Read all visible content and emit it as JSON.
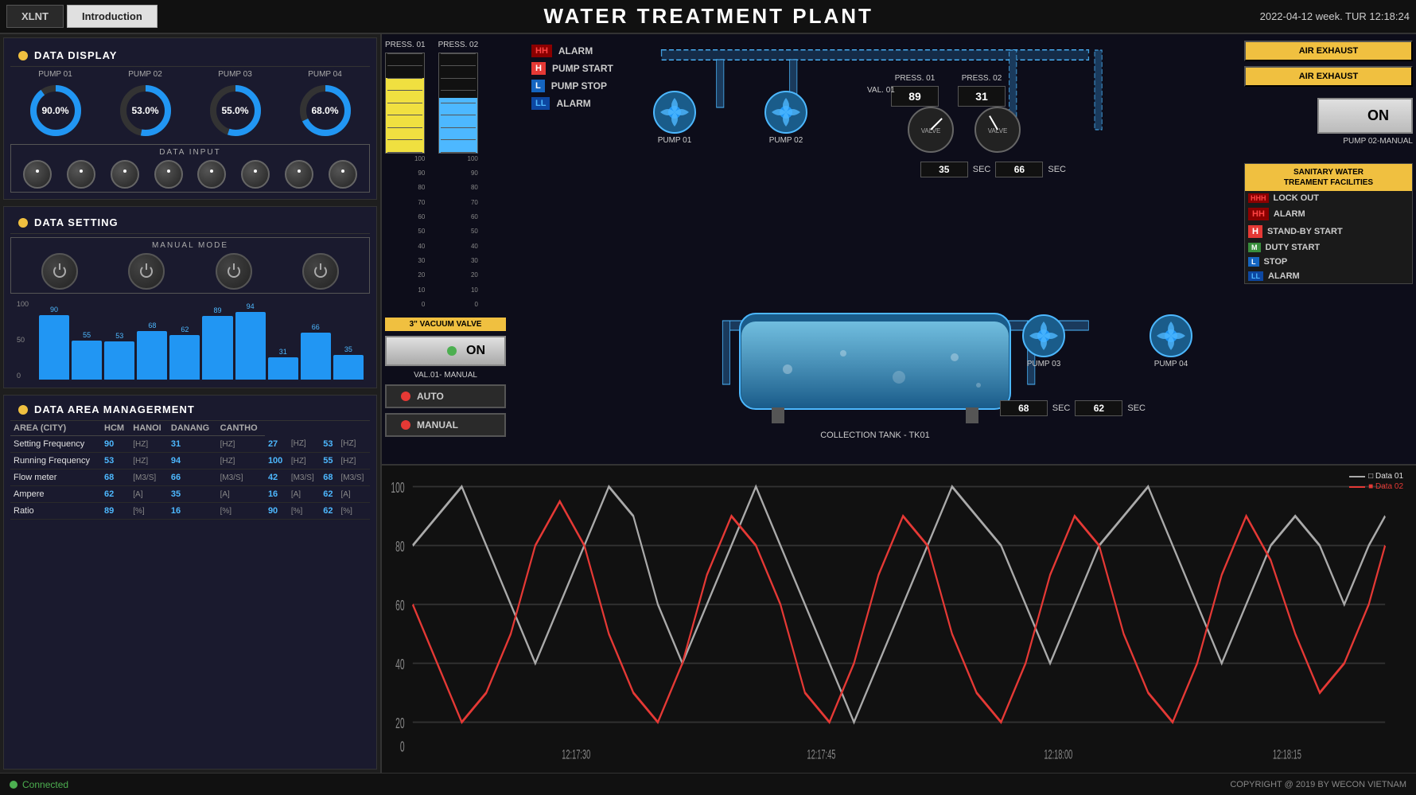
{
  "topbar": {
    "tab_xlnt": "XLNT",
    "tab_intro": "Introduction",
    "app_title": "WATER TREATMENT PLANT",
    "datetime": "2022-04-12  week. TUR  12:18:24"
  },
  "data_display": {
    "title": "DATA DISPLAY",
    "pumps": [
      {
        "label": "PUMP 01",
        "value": "90.0%",
        "pct": 90
      },
      {
        "label": "PUMP 02",
        "value": "53.0%",
        "pct": 53
      },
      {
        "label": "PUMP 03",
        "value": "55.0%",
        "pct": 55
      },
      {
        "label": "PUMP 04",
        "value": "68.0%",
        "pct": 68
      }
    ],
    "data_input_label": "DATA INPUT"
  },
  "data_setting": {
    "title": "DATA SETTING",
    "manual_mode_label": "MANUAL MODE",
    "bar_values": [
      90,
      55,
      53,
      68,
      62,
      89,
      94,
      31,
      66,
      35
    ]
  },
  "data_area": {
    "title": "DATA AREA MANAGERMENT",
    "columns": [
      "AREA (CITY)",
      "HCM",
      "HANOI",
      "DANANG",
      "CANTHO"
    ],
    "rows": [
      {
        "label": "Setting Frequency",
        "hcm": "90",
        "hcm_unit": "[HZ]",
        "hanoi": "31",
        "hanoi_unit": "[HZ]",
        "danang": "27",
        "danang_unit": "[HZ]",
        "cantho": "53",
        "cantho_unit": "[HZ]"
      },
      {
        "label": "Running Frequency",
        "hcm": "53",
        "hcm_unit": "[HZ]",
        "hanoi": "94",
        "hanoi_unit": "[HZ]",
        "danang": "100",
        "danang_unit": "[HZ]",
        "cantho": "55",
        "cantho_unit": "[HZ]"
      },
      {
        "label": "Flow meter",
        "hcm": "68",
        "hcm_unit": "[M3/S]",
        "hanoi": "66",
        "hanoi_unit": "[M3/S]",
        "danang": "42",
        "danang_unit": "[M3/S]",
        "cantho": "68",
        "cantho_unit": "[M3/S]"
      },
      {
        "label": "Ampere",
        "hcm": "62",
        "hcm_unit": "[A]",
        "hanoi": "35",
        "hanoi_unit": "[A]",
        "danang": "16",
        "danang_unit": "[A]",
        "cantho": "62",
        "cantho_unit": "[A]"
      },
      {
        "label": "Ratio",
        "hcm": "89",
        "hcm_unit": "[%]",
        "hanoi": "16",
        "hanoi_unit": "[%]",
        "danang": "90",
        "danang_unit": "[%]",
        "cantho": "62",
        "cantho_unit": "[%]"
      }
    ]
  },
  "scada": {
    "press1_label": "PRESS. 01",
    "press2_label": "PRESS. 02",
    "press1_fill_pct": 75,
    "press2_fill_pct": 55,
    "vacuum_valve_label": "3\" VACUUM VALVE",
    "val01_label": "VAL. 01",
    "val01_manual_label": "VAL.01- MANUAL",
    "on_label": "ON",
    "auto_label": "AUTO",
    "manual_label": "MANUAL",
    "tank_label": "COLLECTION TANK - TK01",
    "alarm_hh": "HH",
    "alarm_h": "H",
    "alarm_l": "L",
    "alarm_ll": "LL",
    "alarm_label": "ALARM",
    "pump_start_label": "PUMP START",
    "pump_stop_label": "PUMP STOP",
    "pump01_label": "PUMP 01",
    "pump02_label": "PUMP 02",
    "pump03_label": "PUMP 03",
    "pump04_label": "PUMP 04",
    "press1_val": "89",
    "press2_val": "31",
    "press1_sec1": "35",
    "press1_sec_label1": "SEC",
    "press1_sec2": "66",
    "press1_sec_label2": "SEC",
    "press1_sec3": "68",
    "press1_sec_label3": "SEC",
    "press1_sec4": "62",
    "press1_sec_label4": "SEC",
    "air_exhaust": "AIR EXHAUST",
    "pump02_manual_label": "PUMP 02-MANUAL",
    "sanitary_label": "SANITARY WATER\nTREAMENT FACILITIES",
    "lockout": "LOCK OUT",
    "stand_by_start": "STAND-BY START",
    "duty_start": "DUTY START",
    "stop_label": "STOP",
    "press1_box": "PRESS. 01",
    "press2_box": "PRESS. 02"
  },
  "chart": {
    "y_labels": [
      "100",
      "80",
      "60",
      "40",
      "20",
      "0"
    ],
    "x_labels": [
      "12:17:30",
      "12:17:45",
      "12:18:00",
      "12:18:15"
    ],
    "legend_data01": "□ Data 01",
    "legend_data02": "■ Data 02"
  },
  "bottom": {
    "connected": "Connected",
    "copyright": "COPYRIGHT @ 2019 BY WECON VIETNAM"
  }
}
